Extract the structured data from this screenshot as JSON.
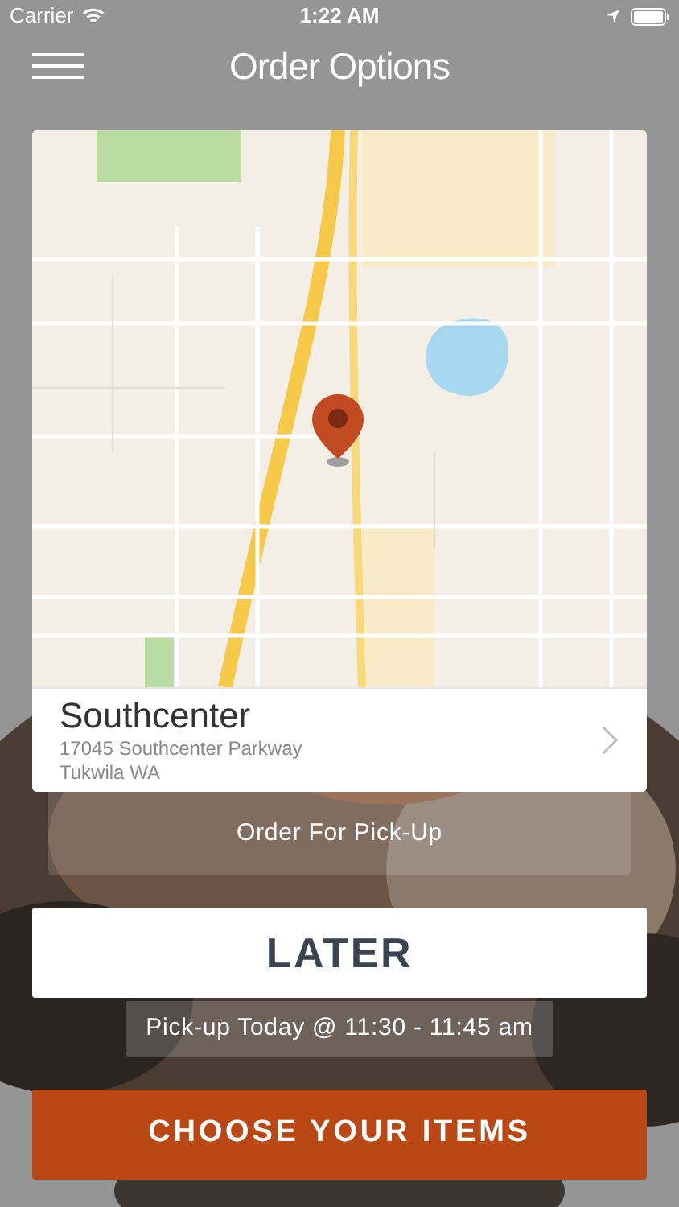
{
  "status_bar": {
    "carrier": "Carrier",
    "time": "1:22 AM"
  },
  "header": {
    "title": "Order Options"
  },
  "location": {
    "name": "Southcenter",
    "address_line_1": "17045 Southcenter Parkway",
    "address_line_2": "Tukwila WA"
  },
  "order_type_button": "Order For Pick-Up",
  "timing": {
    "label": "LATER",
    "detail": "Pick-up Today @ 11:30 - 11:45 am"
  },
  "primary_button": "CHOOSE YOUR ITEMS"
}
